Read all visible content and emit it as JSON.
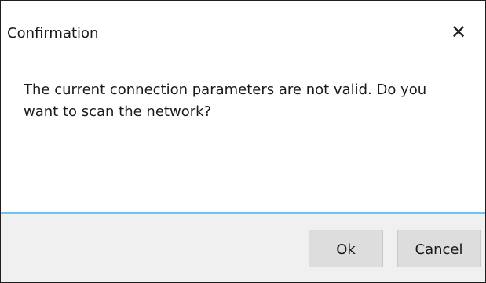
{
  "dialog": {
    "title": "Confirmation",
    "close_glyph": "✕",
    "message": "The current connection parameters are not valid. Do you want to scan the network?",
    "buttons": {
      "ok_label": "Ok",
      "cancel_label": "Cancel"
    },
    "colors": {
      "accent_separator": "#6cc6f0",
      "footer_background": "#f0f0f0",
      "button_background": "#dddddd"
    },
    "icons": {
      "close": "close-icon"
    }
  }
}
